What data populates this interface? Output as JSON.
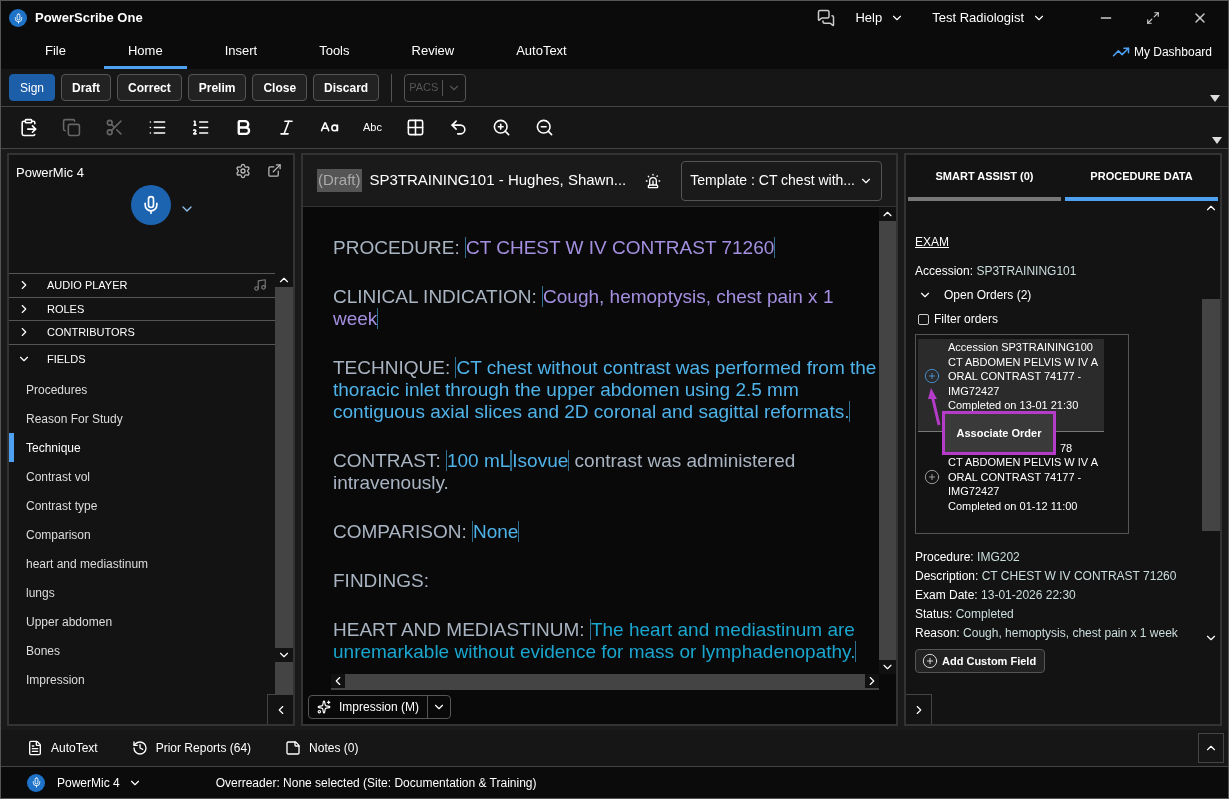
{
  "window": {
    "title": "PowerScribe One"
  },
  "header": {
    "help": "Help",
    "user": "Test Radiologist",
    "dashboard": "My Dashboard"
  },
  "menu_tabs": [
    {
      "label": "File",
      "selected": false
    },
    {
      "label": "Home",
      "selected": true
    },
    {
      "label": "Insert",
      "selected": false
    },
    {
      "label": "Tools",
      "selected": false
    },
    {
      "label": "Review",
      "selected": false
    },
    {
      "label": "AutoText",
      "selected": false
    }
  ],
  "actions": [
    {
      "label": "Sign",
      "primary": true
    },
    {
      "label": "Draft",
      "primary": false
    },
    {
      "label": "Correct",
      "primary": false
    },
    {
      "label": "Prelim",
      "primary": false
    },
    {
      "label": "Close",
      "primary": false
    },
    {
      "label": "Discard",
      "primary": false
    }
  ],
  "pacs": {
    "label": "PACS",
    "disabled": true
  },
  "format_tools": [
    {
      "kind": "paste",
      "disabled": false
    },
    {
      "kind": "copy",
      "disabled": true
    },
    {
      "kind": "cut",
      "disabled": true
    },
    {
      "kind": "bullets",
      "disabled": false
    },
    {
      "kind": "numbers",
      "disabled": false
    },
    {
      "kind": "bold",
      "disabled": false
    },
    {
      "kind": "italic",
      "disabled": false
    },
    {
      "kind": "case",
      "disabled": false
    },
    {
      "kind": "spell",
      "label": "Abc",
      "disabled": false
    },
    {
      "kind": "table",
      "disabled": false
    },
    {
      "kind": "undo",
      "disabled": false
    },
    {
      "kind": "zoom-in",
      "disabled": false
    },
    {
      "kind": "zoom-out",
      "disabled": false
    }
  ],
  "left_panel": {
    "title": "PowerMic 4",
    "sections": [
      {
        "label": "AUDIO PLAYER",
        "expanded": false
      },
      {
        "label": "ROLES",
        "expanded": false
      },
      {
        "label": "CONTRIBUTORS",
        "expanded": false
      },
      {
        "label": "FIELDS",
        "expanded": true
      }
    ],
    "fields": [
      {
        "label": "Procedures",
        "selected": false
      },
      {
        "label": "Reason For Study",
        "selected": false
      },
      {
        "label": "Technique",
        "selected": true
      },
      {
        "label": "Contrast vol",
        "selected": false
      },
      {
        "label": "Contrast type",
        "selected": false
      },
      {
        "label": "Comparison",
        "selected": false
      },
      {
        "label": "heart and mediastinum",
        "selected": false
      },
      {
        "label": "lungs",
        "selected": false
      },
      {
        "label": "Upper abdomen",
        "selected": false
      },
      {
        "label": "Bones",
        "selected": false
      },
      {
        "label": "Impression",
        "selected": false
      }
    ]
  },
  "editor": {
    "status": "(Draft)",
    "title": "SP3TRAINING101 - Hughes, Shawn...",
    "template": "Template : CT chest with...",
    "report": [
      {
        "label": "PROCEDURE:",
        "parts": [
          {
            "kind": "field",
            "text": "CT CHEST W IV CONTRAST 71260",
            "color": "#a48fe0"
          }
        ]
      },
      {
        "label": "CLINICAL INDICATION:",
        "parts": [
          {
            "kind": "field",
            "text": "Cough, hemoptysis, chest pain x 1 week",
            "color": "#a48fe0"
          }
        ]
      },
      {
        "label": "TECHNIQUE:",
        "parts": [
          {
            "kind": "field",
            "text": "CT chest without contrast was performed from the thoracic inlet through the upper abdomen using 2.5 mm contiguous axial slices and 2D coronal and sagittal reformats.",
            "color": "#4fb3ea"
          }
        ]
      },
      {
        "label": "CONTRAST:",
        "parts": [
          {
            "kind": "field",
            "text": "100 mL",
            "color": "#4fb3ea"
          },
          {
            "kind": "field",
            "text": "Isovue",
            "color": "#4fb3ea"
          },
          {
            "kind": "plain",
            "text": "contrast was administered intravenously.",
            "color": "#a9b4c2"
          }
        ]
      },
      {
        "label": "COMPARISON:",
        "parts": [
          {
            "kind": "field",
            "text": "None",
            "color": "#4fb3ea"
          }
        ]
      },
      {
        "label": "FINDINGS:"
      },
      {
        "label": "HEART AND MEDIASTINUM:",
        "parts": [
          {
            "kind": "field",
            "text": "The heart and mediastinum are unremarkable without evidence for mass or lymphadenopathy.",
            "color": "#1aa6cf"
          }
        ]
      }
    ],
    "impression_button": "Impression (M)"
  },
  "right_panel": {
    "tabs": [
      {
        "label": "SMART ASSIST (0)",
        "selected": false
      },
      {
        "label": "PROCEDURE DATA",
        "selected": true
      }
    ],
    "section": "EXAM",
    "accession": {
      "label": "Accession:",
      "value": "SP3TRAINING101"
    },
    "open_orders": {
      "label": "Open Orders (2)",
      "expanded": true
    },
    "filter": {
      "label": "Filter orders",
      "checked": false
    },
    "orders": [
      {
        "lines": [
          "Accession SP3TRAINING100",
          "CT ABDOMEN PELVIS W IV A",
          "ORAL CONTRAST 74177 -",
          "IMG72427",
          "Completed on 13-01 21:30"
        ],
        "hovered": true
      },
      {
        "lines": [
          "78",
          "CT ABDOMEN PELVIS W IV A",
          "ORAL CONTRAST 74177 -",
          "IMG72427",
          "Completed on 01-12 11:00"
        ],
        "hovered": false
      }
    ],
    "tooltip": "Associate Order",
    "details": [
      {
        "label": "Procedure:",
        "value": "IMG202"
      },
      {
        "label": "Description:",
        "value": "CT CHEST W IV CONTRAST 71260"
      },
      {
        "label": "Exam Date:",
        "value": "13-01-2026 22:30"
      },
      {
        "label": "Status:",
        "value": "Completed"
      },
      {
        "label": "Reason:",
        "value": "Cough, hemoptysis, chest pain x 1 week"
      }
    ],
    "add_field": "Add Custom Field"
  },
  "bottom_tabs": [
    {
      "kind": "autotext",
      "label": "AutoText"
    },
    {
      "kind": "prior",
      "label": "Prior Reports (64)"
    },
    {
      "kind": "notes",
      "label": "Notes (0)"
    }
  ],
  "status_bar": {
    "device": "PowerMic 4",
    "text": "Overreader: None selected (Site: Documentation & Training)"
  }
}
